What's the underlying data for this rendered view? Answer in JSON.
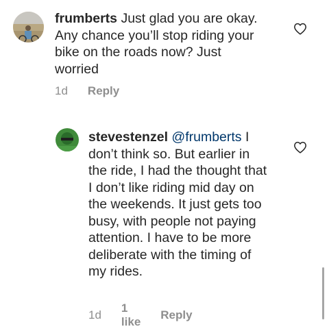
{
  "comments": [
    {
      "username": "frumberts",
      "text": "Just glad you are okay. Any chance you’ll stop riding your bike on the roads now? Just worried",
      "time": "1d",
      "reply_label": "Reply"
    },
    {
      "username": "stevestenzel",
      "mention": "@frumberts",
      "text": "I don’t think so. But earlier in the ride, I had the thought that I don’t like riding mid day on the weekends. It just gets too busy, with people not paying attention. I have to be more deliberate with the timing of my rides.",
      "time": "1d",
      "likes": "1 like",
      "reply_label": "Reply"
    }
  ],
  "icons": {
    "like": "heart-outline-icon",
    "avatar1": "avatar-photo-desert",
    "avatar2": "avatar-photo-green"
  },
  "colors": {
    "text": "#262626",
    "secondary": "#8e8e8e",
    "mention": "#00376b"
  }
}
